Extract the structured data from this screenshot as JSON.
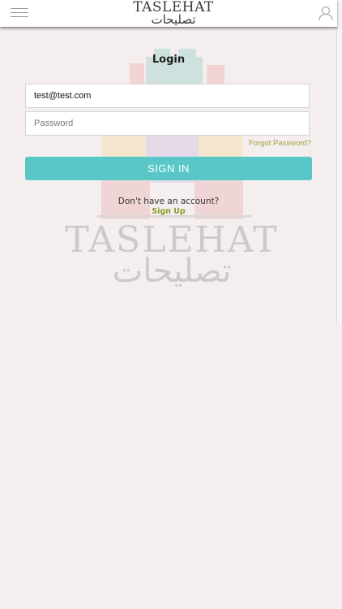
{
  "header": {
    "logo_en": "TASLEHAT",
    "logo_ar": "تصليحات",
    "menu_icon": "hamburger-menu-icon",
    "user_icon": "user-outline-icon"
  },
  "watermark": {
    "text_en": "TASLEHAT",
    "text_ar": "تصليحات"
  },
  "login": {
    "title": "Login",
    "email_value": "test@test.com",
    "password_placeholder": "Password",
    "forgot_label": "Forgot Password?",
    "signin_label": "SIGN IN",
    "no_account_text": "Don't have an account?",
    "signup_label": "Sign Up"
  },
  "colors": {
    "background": "#f4eeee",
    "accent": "#59c7c8",
    "link": "#a4a23a",
    "signup": "#8a9a2c"
  }
}
